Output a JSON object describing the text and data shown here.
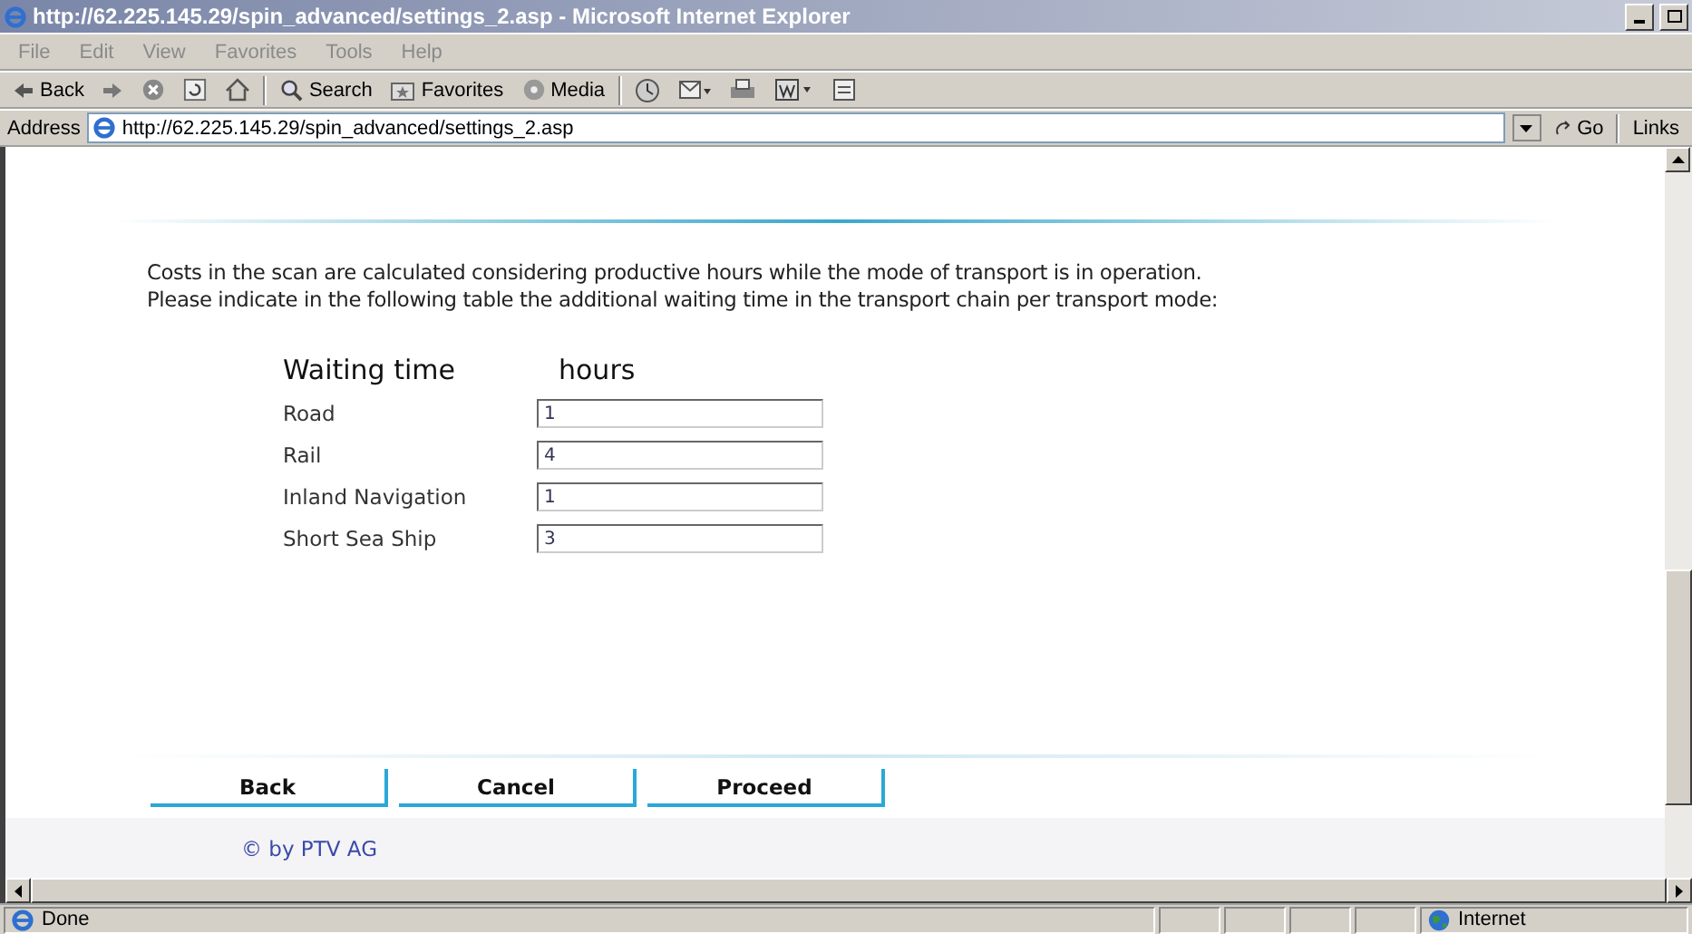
{
  "window": {
    "title": "http://62.225.145.29/spin_advanced/settings_2.asp - Microsoft Internet Explorer"
  },
  "menu": [
    "File",
    "Edit",
    "View",
    "Favorites",
    "Tools",
    "Help"
  ],
  "toolbar": [
    {
      "kind": "back",
      "label": "Back"
    },
    {
      "kind": "forward"
    },
    {
      "kind": "stop"
    },
    {
      "kind": "refresh"
    },
    {
      "kind": "home"
    },
    {
      "kind": "search",
      "label": "Search"
    },
    {
      "kind": "favorites",
      "label": "Favorites"
    },
    {
      "kind": "media",
      "label": "Media"
    },
    {
      "kind": "history"
    },
    {
      "kind": "mail"
    },
    {
      "kind": "print"
    },
    {
      "kind": "edit"
    },
    {
      "kind": "discuss"
    }
  ],
  "address": {
    "label": "Address",
    "url": "http://62.225.145.29/spin_advanced/settings_2.asp",
    "go": "Go",
    "links": "Links"
  },
  "intro": [
    "Costs in the scan are calculated considering productive hours while the mode of transport is in operation.",
    "Please indicate in the following table the additional waiting time in the transport chain per transport mode:"
  ],
  "table": {
    "columns": [
      "Waiting time",
      "hours"
    ],
    "rows": [
      {
        "label": "Road",
        "value": "1"
      },
      {
        "label": "Rail",
        "value": "4"
      },
      {
        "label": "Inland Navigation",
        "value": "1"
      },
      {
        "label": "Short Sea Ship",
        "value": "3"
      }
    ]
  },
  "buttons": [
    "Back",
    "Cancel",
    "Proceed"
  ],
  "footer": "© by PTV AG",
  "status_bar": {
    "text": "Done",
    "zone": "Internet"
  }
}
